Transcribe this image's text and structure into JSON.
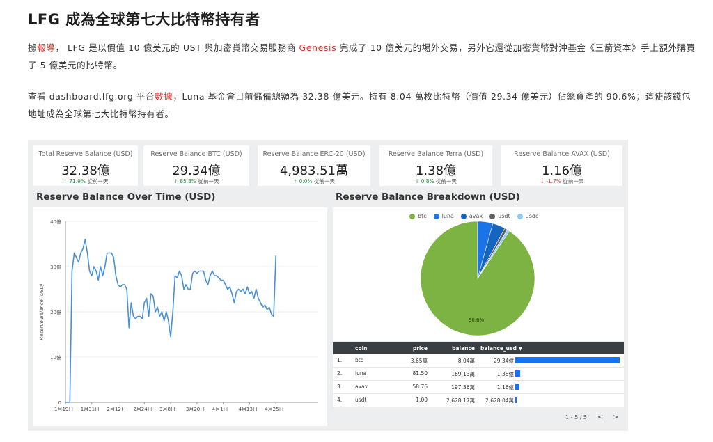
{
  "article": {
    "title": "LFG 成為全球第七大比特幣持有者",
    "p1_a": "據",
    "p1_link": "報導",
    "p1_b": "， LFG 是以價值 10 億美元的 UST 與加密貨幣交易服務商 ",
    "p1_genesis": "Genesis",
    "p1_c": " 完成了 10 億美元的場外交易，另外它還從加密貨幣對沖基金《三箭資本》手上額外購買了 5 億美元的比特幣。",
    "p2_a": "查看 dashboard.lfg.org 平台",
    "p2_link": "數據",
    "p2_b": "，Luna 基金會目前儲備總額為 32.38 億美元。持有 8.04 萬枚比特幣（價值 29.34 億美元）佔總資產的 90.6%；這使該錢包地址成為全球第七大比特幣持有者。"
  },
  "cards": [
    {
      "label": "Total Reserve Balance (USD)",
      "value": "32.38億",
      "change": "71.9%",
      "dir": "up",
      "since": "從前一天"
    },
    {
      "label": "Reserve Balance BTC (USD)",
      "value": "29.34億",
      "change": "85.8%",
      "dir": "up",
      "since": "從前一天"
    },
    {
      "label": "Reserve Balance ERC-20 (USD)",
      "value": "4,983.51萬",
      "change": "0.0%",
      "dir": "up",
      "since": "從前一天"
    },
    {
      "label": "Reserve Balance Terra (USD)",
      "value": "1.38億",
      "change": "0.8%",
      "dir": "up",
      "since": "從前一天"
    },
    {
      "label": "Reserve Balance AVAX (USD)",
      "value": "1.16億",
      "change": "-1.7%",
      "dir": "down",
      "since": "從前一天"
    }
  ],
  "line_panel": {
    "title": "Reserve Balance Over Time (USD)",
    "ylabel": "Reserve Balance (USD)"
  },
  "pie_panel": {
    "title": "Reserve Balance Breakdown (USD)",
    "slice_label": "90.6%"
  },
  "table": {
    "headers": [
      "coin",
      "price",
      "balance",
      "balance_usd ▼"
    ],
    "rows": [
      {
        "idx": "1.",
        "coin": "btc",
        "price": "3.65萬",
        "balance": "8.04萬",
        "usd": "29.34億",
        "frac": 1.0
      },
      {
        "idx": "2.",
        "coin": "luna",
        "price": "81.50",
        "balance": "169.13萬",
        "usd": "1.38億",
        "frac": 0.047
      },
      {
        "idx": "3.",
        "coin": "avax",
        "price": "58.76",
        "balance": "197.36萬",
        "usd": "1.16億",
        "frac": 0.04
      },
      {
        "idx": "4.",
        "coin": "usdt",
        "price": "1.00",
        "balance": "2,628.17萬",
        "usd": "2,628.04萬",
        "frac": 0.009
      }
    ],
    "pager": "1 - 5 / 5",
    "prev": "<",
    "next": ">"
  },
  "colors": {
    "btc": "#7cb342",
    "luna": "#1a73e8",
    "avax": "#1565c0",
    "usdt": "#5f6368",
    "usdc": "#90caf9",
    "line": "#4a90d9"
  },
  "chart_data": [
    {
      "type": "line",
      "title": "Reserve Balance Over Time (USD)",
      "ylabel": "Reserve Balance (USD)",
      "ylim": [
        0,
        40
      ],
      "yticks": [
        "0",
        "10億",
        "20億",
        "30億",
        "40億"
      ],
      "xticks": [
        "1月19日",
        "1月31日",
        "2月12日",
        "2月24日",
        "3月8日",
        "3月20日",
        "4月1日",
        "4月13日",
        "4月25日"
      ],
      "x_range": [
        0,
        115
      ],
      "x_tick_pos": [
        0,
        12,
        24,
        36,
        48,
        60,
        72,
        84,
        96
      ],
      "series": [
        {
          "values": [
            [
              0,
              0
            ],
            [
              2,
              0
            ],
            [
              3,
              29
            ],
            [
              4,
              33
            ],
            [
              5,
              32
            ],
            [
              6,
              31
            ],
            [
              7,
              33
            ],
            [
              8,
              34
            ],
            [
              9,
              36
            ],
            [
              10,
              33
            ],
            [
              11,
              29
            ],
            [
              12,
              28
            ],
            [
              13,
              30
            ],
            [
              14,
              29
            ],
            [
              15,
              27
            ],
            [
              16,
              30
            ],
            [
              17,
              28
            ],
            [
              18,
              30
            ],
            [
              19,
              33
            ],
            [
              20,
              33
            ],
            [
              21,
              33
            ],
            [
              22,
              32
            ],
            [
              23,
              28
            ],
            [
              24,
              26
            ],
            [
              25,
              25.5
            ],
            [
              26,
              26
            ],
            [
              27,
              26
            ],
            [
              28,
              25
            ],
            [
              29,
              16.5
            ],
            [
              30,
              22
            ],
            [
              31,
              19
            ],
            [
              32,
              18.5
            ],
            [
              33,
              19
            ],
            [
              34,
              19
            ],
            [
              35,
              18.5
            ],
            [
              36,
              22
            ],
            [
              37,
              23
            ],
            [
              38,
              19
            ],
            [
              39,
              24
            ],
            [
              40,
              23.5
            ],
            [
              41,
              20
            ],
            [
              42,
              21
            ],
            [
              43,
              19
            ],
            [
              44,
              20
            ],
            [
              45,
              18
            ],
            [
              46,
              20
            ],
            [
              47,
              18
            ],
            [
              48,
              14.5
            ],
            [
              49,
              20
            ],
            [
              50,
              28
            ],
            [
              51,
              27.5
            ],
            [
              52,
              29
            ],
            [
              53,
              28
            ],
            [
              54,
              25
            ],
            [
              55,
              26
            ],
            [
              56,
              25
            ],
            [
              57,
              25
            ],
            [
              58,
              28.5
            ],
            [
              59,
              29
            ],
            [
              60,
              28.5
            ],
            [
              61,
              29
            ],
            [
              62,
              29
            ],
            [
              63,
              29
            ],
            [
              64,
              27
            ],
            [
              65,
              26
            ],
            [
              66,
              28
            ],
            [
              67,
              29
            ],
            [
              68,
              28
            ],
            [
              69,
              28
            ],
            [
              70,
              27.5
            ],
            [
              71,
              27
            ],
            [
              72,
              27
            ],
            [
              73,
              26
            ],
            [
              74,
              25
            ],
            [
              75,
              25.5
            ],
            [
              76,
              24
            ],
            [
              77,
              22
            ],
            [
              78,
              24.5
            ],
            [
              79,
              25
            ],
            [
              80,
              24.5
            ],
            [
              81,
              25
            ],
            [
              82,
              24
            ],
            [
              83,
              25.5
            ],
            [
              84,
              24
            ],
            [
              85,
              24.5
            ],
            [
              86,
              23
            ],
            [
              87,
              25
            ],
            [
              88,
              23
            ],
            [
              89,
              22
            ],
            [
              90,
              21
            ],
            [
              91,
              21.5
            ],
            [
              92,
              20.5
            ],
            [
              93,
              21
            ],
            [
              94,
              19.5
            ],
            [
              95,
              19
            ],
            [
              96,
              32.38
            ]
          ]
        }
      ]
    },
    {
      "type": "pie",
      "title": "Reserve Balance Breakdown (USD)",
      "legend": "top",
      "categories": [
        "btc",
        "luna",
        "avax",
        "usdt",
        "usdc"
      ],
      "values": [
        90.6,
        4.3,
        3.6,
        0.8,
        0.7
      ]
    }
  ]
}
